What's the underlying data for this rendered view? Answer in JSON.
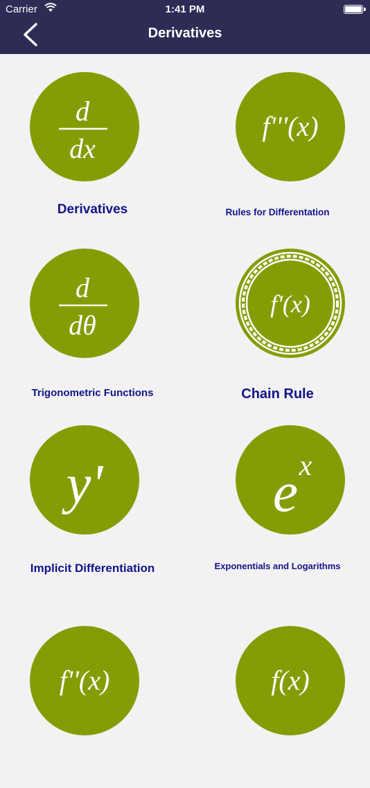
{
  "status_bar": {
    "carrier": "Carrier",
    "time": "1:41 PM"
  },
  "nav": {
    "title": "Derivatives"
  },
  "items": [
    {
      "label": "Derivatives",
      "icon_numerator": "d",
      "icon_denominator": "dx"
    },
    {
      "label": "Rules for Differentation",
      "icon_text": "f'''(x)"
    },
    {
      "label": "Trigonometric Functions",
      "icon_numerator": "d",
      "icon_denominator": "dθ"
    },
    {
      "label": "Chain Rule",
      "icon_text": "f'(x)"
    },
    {
      "label": "Implicit Differentiation",
      "icon_text": "y'"
    },
    {
      "label": "Exponentials and Logarithms",
      "icon_base": "e",
      "icon_exp": "x"
    },
    {
      "icon_text": "f''(x)"
    },
    {
      "icon_text": "f(x)"
    }
  ],
  "colors": {
    "nav_bg": "#2e2b55",
    "circle": "#869c05",
    "label": "#14138a",
    "background": "#f2f2f2"
  }
}
